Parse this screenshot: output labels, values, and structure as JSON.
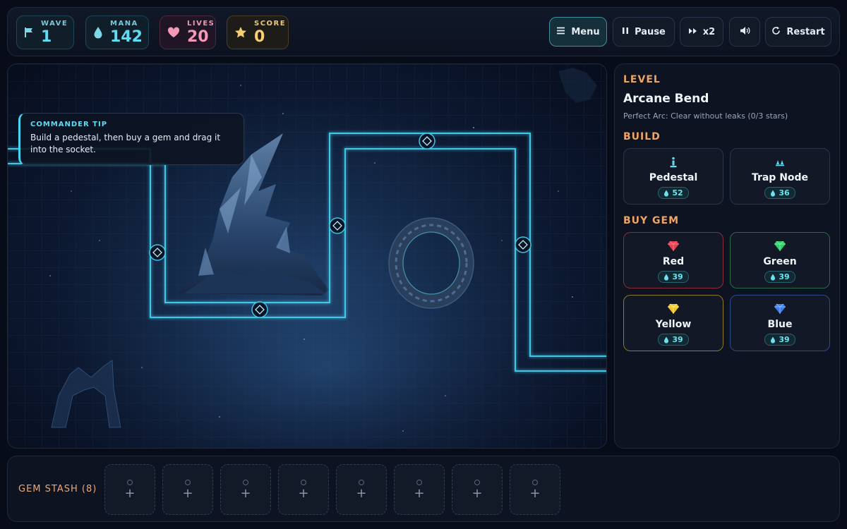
{
  "stats": {
    "wave": {
      "label": "WAVE",
      "value": "1",
      "icon": "flag-icon"
    },
    "mana": {
      "label": "MANA",
      "value": "142",
      "icon": "droplet-icon"
    },
    "lives": {
      "label": "LIVES",
      "value": "20",
      "icon": "heart-icon"
    },
    "score": {
      "label": "SCORE",
      "value": "0",
      "icon": "star-icon"
    }
  },
  "toolbar": {
    "menu_label": "Menu",
    "pause_label": "Pause",
    "speed_label": "x2",
    "restart_label": "Restart"
  },
  "tip": {
    "title": "COMMANDER TIP",
    "text": "Build a pedestal, then buy a gem and drag it into the socket."
  },
  "panel": {
    "level_heading": "LEVEL",
    "level_name": "Arcane Bend",
    "level_objective": "Perfect Arc: Clear without leaks (0/3 stars)",
    "build_heading": "BUILD",
    "build_items": [
      {
        "name": "Pedestal",
        "cost": "52",
        "icon": "pedestal-icon"
      },
      {
        "name": "Trap Node",
        "cost": "36",
        "icon": "trap-icon"
      }
    ],
    "gem_heading": "BUY GEM",
    "gems": [
      {
        "name": "Red",
        "cost": "39",
        "color": "#e8404f"
      },
      {
        "name": "Green",
        "cost": "39",
        "color": "#2fcf6a"
      },
      {
        "name": "Yellow",
        "cost": "39",
        "color": "#f2c623"
      },
      {
        "name": "Blue",
        "cost": "39",
        "color": "#3b7ef0"
      }
    ]
  },
  "stash": {
    "label": "GEM STASH (8)",
    "slot_count": 8
  },
  "colors": {
    "accent_cyan": "#48d4ee",
    "heading_orange": "#f0a464",
    "path_glow": "#3fc6e6"
  }
}
